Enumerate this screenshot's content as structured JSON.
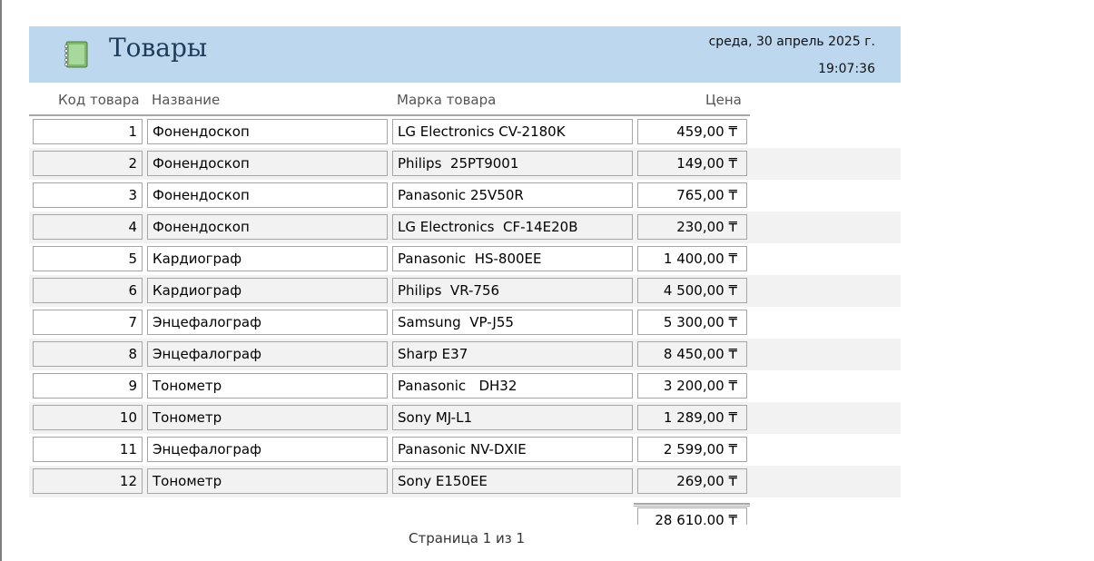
{
  "report": {
    "title": "Товары",
    "date": "среда, 30 апрель 2025 г.",
    "time": "19:07:36",
    "icon": "notebook-icon"
  },
  "columns": {
    "id": "Код товара",
    "name": "Название",
    "brand": "Марка товара",
    "price": "Цена"
  },
  "rows": [
    {
      "id": "1",
      "name": "Фонендоскоп",
      "brand": "LG Electronics CV-2180K",
      "price": "459,00 ₸"
    },
    {
      "id": "2",
      "name": "Фонендоскоп",
      "brand": "Philips  25PT9001",
      "price": "149,00 ₸"
    },
    {
      "id": "3",
      "name": "Фонендоскоп",
      "brand": "Panasonic 25V50R",
      "price": "765,00 ₸"
    },
    {
      "id": "4",
      "name": "Фонендоскоп",
      "brand": "LG Electronics  CF-14E20B",
      "price": "230,00 ₸"
    },
    {
      "id": "5",
      "name": "Кардиограф",
      "brand": "Panasonic  HS-800EE",
      "price": "1 400,00 ₸"
    },
    {
      "id": "6",
      "name": "Кардиограф",
      "brand": "Philips  VR-756",
      "price": "4 500,00 ₸"
    },
    {
      "id": "7",
      "name": "Энцефалограф",
      "brand": "Samsung  VP-J55",
      "price": "5 300,00 ₸"
    },
    {
      "id": "8",
      "name": "Энцефалограф",
      "brand": "Sharp E37",
      "price": "8 450,00 ₸"
    },
    {
      "id": "9",
      "name": "Тонометр",
      "brand": "Panasonic   DH32",
      "price": "3 200,00 ₸"
    },
    {
      "id": "10",
      "name": "Тонометр",
      "brand": "Sony MJ-L1",
      "price": "1 289,00 ₸"
    },
    {
      "id": "11",
      "name": "Энцефалограф",
      "brand": "Panasonic NV-DXIE",
      "price": "2 599,00 ₸"
    },
    {
      "id": "12",
      "name": "Тонометр",
      "brand": "Sony E150EE",
      "price": "269,00 ₸"
    }
  ],
  "total": "28 610,00 ₸",
  "footer": {
    "page_label": "Страница 1 из 1"
  }
}
